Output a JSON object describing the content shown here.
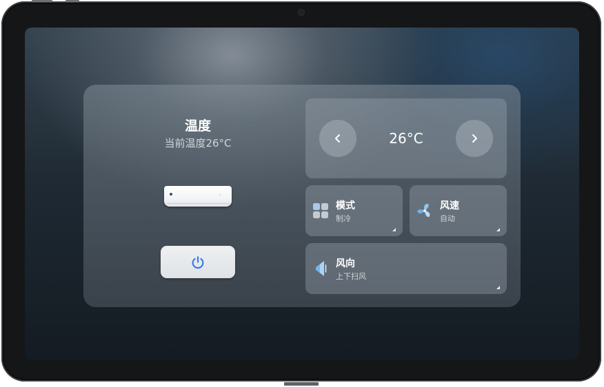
{
  "left": {
    "title": "温度",
    "current_temp": "当前温度26°C",
    "device_icon": "air-conditioner-icon",
    "power_icon": "power-icon"
  },
  "temperature": {
    "value": "26°C",
    "decrease_icon": "chevron-left-icon",
    "increase_icon": "chevron-right-icon"
  },
  "mode": {
    "title": "模式",
    "value": "制冷",
    "icon": "grid-icon"
  },
  "fan": {
    "title": "风速",
    "value": "自动",
    "icon": "fan-icon"
  },
  "direction": {
    "title": "风向",
    "value": "上下扫风",
    "icon": "louver-icon"
  },
  "colors": {
    "accent": "#3a7be8",
    "louver": "#6fb6ea",
    "panel_text": "#ffffff"
  }
}
